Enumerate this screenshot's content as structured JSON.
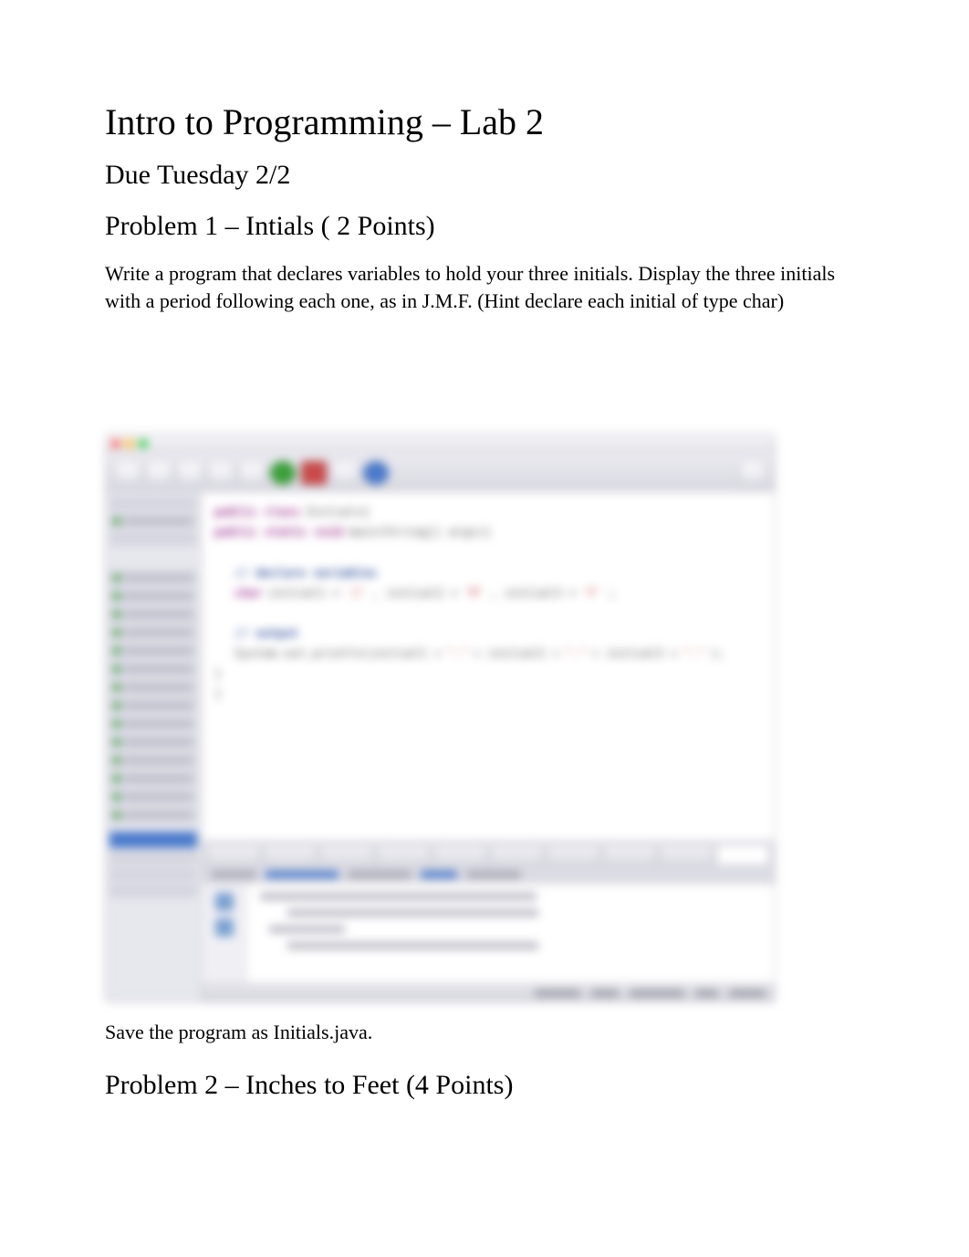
{
  "title": "Intro to Programming – Lab 2",
  "due": "Due Tuesday 2/2",
  "problem1": {
    "heading": "Problem 1 – Intials  ( 2 Points)",
    "body": "Write a program that declares variables to hold your three initials. Display the three initials with a period following each one, as in J.M.F.  (Hint declare each initial of type char)",
    "save": "Save the program as   Initials.java."
  },
  "problem2": {
    "heading": "Problem 2 – Inches to Feet (4 Points)"
  }
}
